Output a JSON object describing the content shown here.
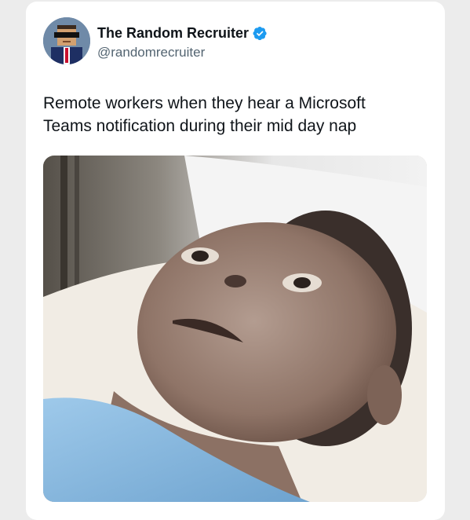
{
  "tweet": {
    "author": {
      "display_name": "The Random Recruiter",
      "handle": "@randomrecruiter",
      "verified": true,
      "verified_icon": "verified-badge-icon"
    },
    "text_lines": [
      "Remote workers when they hear a Microsoft",
      "Teams notification during their mid day nap"
    ],
    "media": {
      "type": "photo"
    }
  },
  "colors": {
    "card_background": "#ffffff",
    "page_background": "#ececec",
    "name_text": "#0f1419",
    "handle_text": "#536471",
    "verified_badge": "#1d9bf0"
  }
}
